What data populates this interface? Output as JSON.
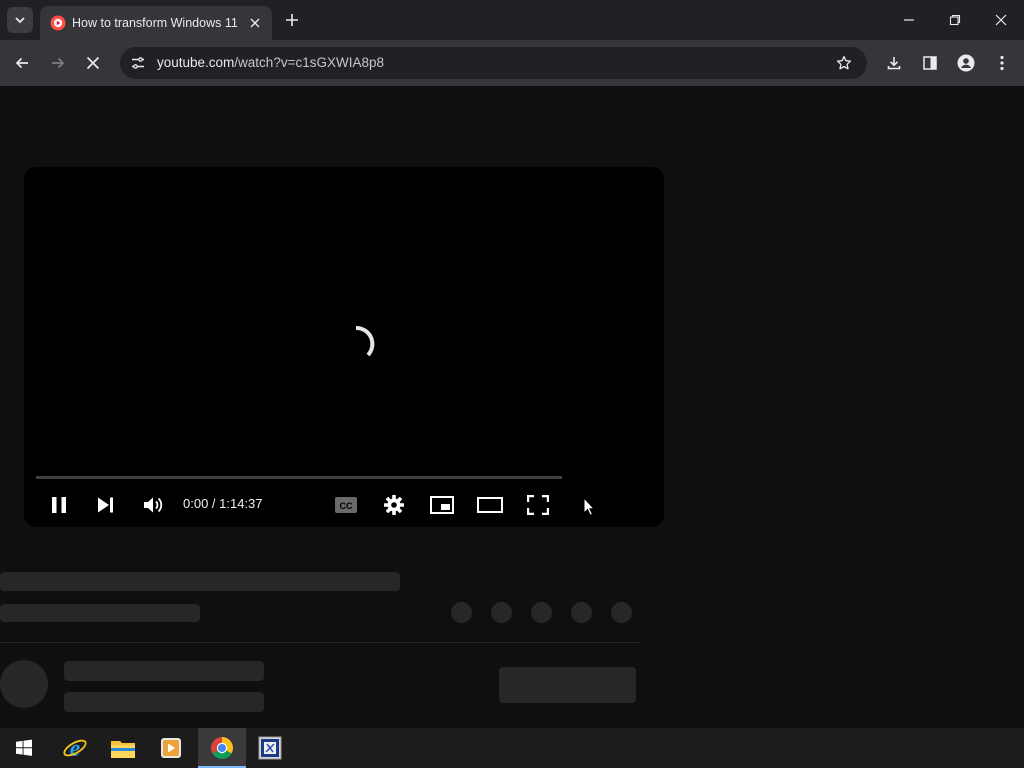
{
  "browser": {
    "tab": {
      "title": "How to transform Windows 11",
      "favicon": "youtube-shorts-icon"
    },
    "url": {
      "host": "youtube.com",
      "path": "/watch?v=c1sGXWIA8p8"
    }
  },
  "player": {
    "time_display": "0:00 / 1:14:37",
    "state": "loading",
    "progress_fraction": 0
  },
  "icons": {
    "tab_list": "chevron-down-icon",
    "new_tab": "plus-icon",
    "minimize": "minimize-icon",
    "restore": "restore-icon",
    "close": "close-icon",
    "back": "arrow-left-icon",
    "forward": "arrow-right-icon",
    "stop": "stop-loading-icon",
    "site_info": "tune-icon",
    "bookmark": "star-icon",
    "download": "download-icon",
    "side_panel": "side-panel-icon",
    "profile": "profile-icon",
    "menu": "kebab-menu-icon"
  },
  "taskbar": {
    "items": [
      "windows-start-icon",
      "internet-explorer-icon",
      "file-explorer-icon",
      "media-player-icon",
      "chrome-icon",
      "window-manager-icon"
    ],
    "active_item": "chrome-icon"
  },
  "colors": {
    "accent_red": "#ff0033",
    "page_bg": "#0f0f0f",
    "placeholder": "#272727"
  }
}
